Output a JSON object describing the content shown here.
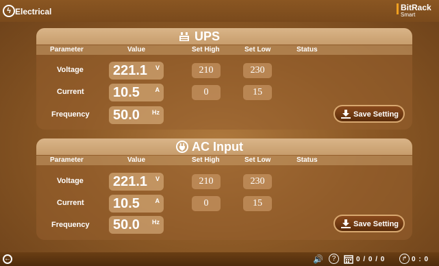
{
  "app": {
    "title": "Electrical",
    "logo_line1": "BitRack",
    "logo_line2": "Smart",
    "brand_color": "#f0a020"
  },
  "columns": [
    "Parameter",
    "Value",
    "Set High",
    "Set Low",
    "Status"
  ],
  "ups": {
    "title": "UPS",
    "icon": "ups-battery-icon",
    "rows": [
      {
        "param": "Voltage",
        "value": "221.1",
        "unit": "V",
        "high": "210",
        "low": "230"
      },
      {
        "param": "Current",
        "value": "10.5",
        "unit": "A",
        "high": "0",
        "low": "15"
      },
      {
        "param": "Frequency",
        "value": "50.0",
        "unit": "Hz"
      }
    ],
    "save_label": "Save Setting"
  },
  "ac": {
    "title": "AC Input",
    "icon": "power-plug-icon",
    "rows": [
      {
        "param": "Voltage",
        "value": "221.1",
        "unit": "V",
        "high": "210",
        "low": "230"
      },
      {
        "param": "Current",
        "value": "10.5",
        "unit": "A",
        "high": "0",
        "low": "15"
      },
      {
        "param": "Frequency",
        "value": "50.0",
        "unit": "Hz"
      }
    ],
    "save_label": "Save Setting"
  },
  "status_bar": {
    "alarm_count": "0 / 0 / 0",
    "time": "0 : 0",
    "icons": [
      "back-icon",
      "volume-icon",
      "help-icon",
      "calendar-icon",
      "clock-icon"
    ]
  }
}
